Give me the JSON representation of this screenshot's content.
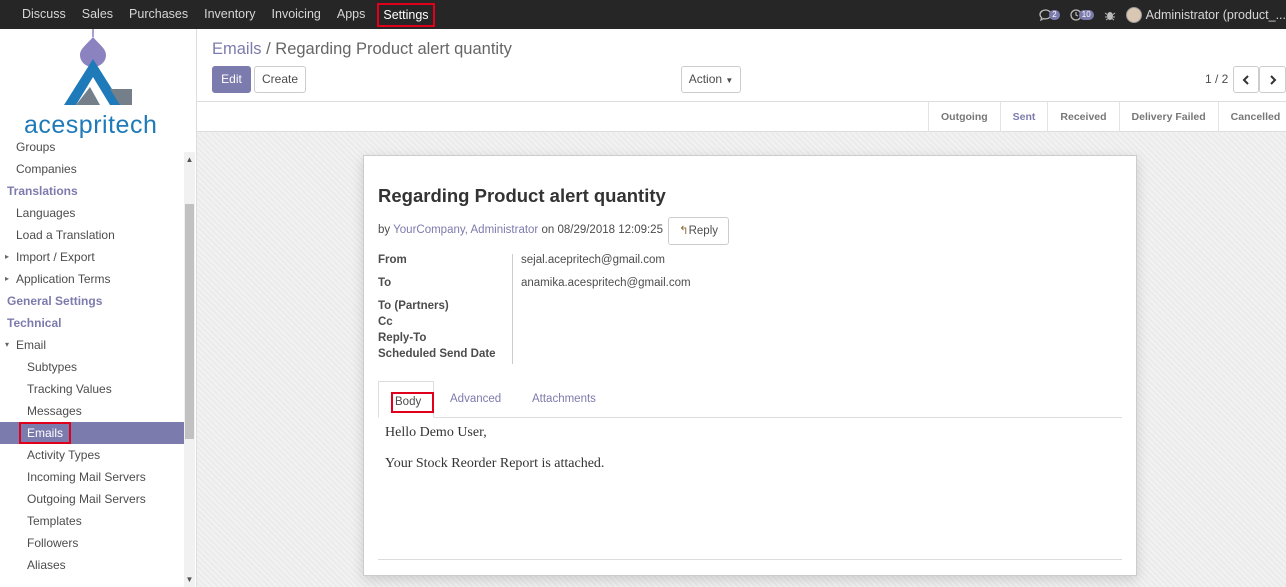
{
  "nav": {
    "menus": [
      "Discuss",
      "Sales",
      "Purchases",
      "Inventory",
      "Invoicing",
      "Apps",
      "Settings"
    ],
    "active_menu": "Settings",
    "chat_count": "2",
    "activity_count": "10",
    "user": "Administrator (product_..."
  },
  "logo": {
    "brand": "acespritech"
  },
  "sidebar": {
    "items": [
      {
        "label": "Groups",
        "level": "l1"
      },
      {
        "label": "Companies",
        "level": "l1"
      },
      {
        "label": "Translations",
        "level": "head"
      },
      {
        "label": "Languages",
        "level": "l1"
      },
      {
        "label": "Load a Translation",
        "level": "l1"
      },
      {
        "label": "Import / Export",
        "level": "l1",
        "caret": "▸"
      },
      {
        "label": "Application Terms",
        "level": "l1",
        "caret": "▸"
      },
      {
        "label": "General Settings",
        "level": "head"
      },
      {
        "label": "Technical",
        "level": "head"
      },
      {
        "label": "Email",
        "level": "l1",
        "caret": "▾"
      },
      {
        "label": "Subtypes",
        "level": "l2"
      },
      {
        "label": "Tracking Values",
        "level": "l2"
      },
      {
        "label": "Messages",
        "level": "l2"
      },
      {
        "label": "Emails",
        "level": "l2",
        "active": true
      },
      {
        "label": "Activity Types",
        "level": "l2"
      },
      {
        "label": "Incoming Mail Servers",
        "level": "l2"
      },
      {
        "label": "Outgoing Mail Servers",
        "level": "l2"
      },
      {
        "label": "Templates",
        "level": "l2"
      },
      {
        "label": "Followers",
        "level": "l2"
      },
      {
        "label": "Aliases",
        "level": "l2"
      }
    ]
  },
  "breadcrumb": {
    "parent": "Emails",
    "separator": " / ",
    "current": "Regarding Product alert quantity"
  },
  "buttons": {
    "edit": "Edit",
    "create": "Create",
    "action": "Action",
    "reply": "Reply"
  },
  "pager": {
    "value": "1 / 2"
  },
  "stages": [
    {
      "label": "Outgoing",
      "current": false
    },
    {
      "label": "Sent",
      "current": true
    },
    {
      "label": "Received",
      "current": false
    },
    {
      "label": "Delivery Failed",
      "current": false
    },
    {
      "label": "Cancelled",
      "current": false
    }
  ],
  "mail": {
    "subject": "Regarding Product alert quantity",
    "by": "by",
    "author": "YourCompany, Administrator",
    "on": "on 08/29/2018 12:09:25",
    "fields": [
      {
        "label": "From",
        "value": "sejal.acepritech@gmail.com"
      },
      {
        "label": "To",
        "value": "anamika.acespritech@gmail.com"
      },
      {
        "label": "To (Partners)",
        "value": ""
      },
      {
        "label": "Cc",
        "value": ""
      },
      {
        "label": "Reply-To",
        "value": ""
      },
      {
        "label": "Scheduled Send Date",
        "value": ""
      }
    ],
    "tabs": [
      "Body",
      "Advanced",
      "Attachments"
    ],
    "body": [
      "Hello Demo User,",
      "Your Stock Reorder Report is attached."
    ]
  },
  "colors": {
    "brand": "#7c7bad",
    "topbar": "#262626",
    "highlight": "#e0001b",
    "logo": "#1e7ab8"
  }
}
